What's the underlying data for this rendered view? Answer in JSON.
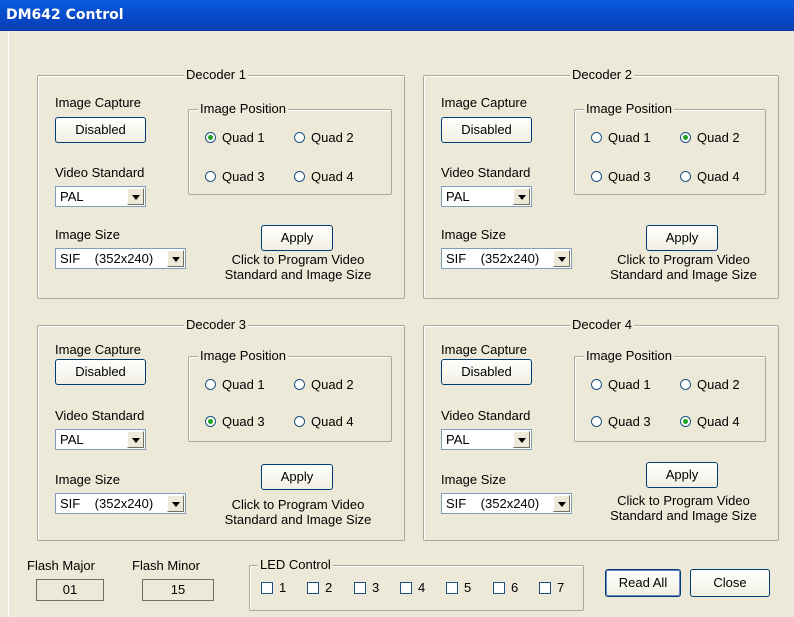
{
  "window": {
    "title": "DM642 Control"
  },
  "labels": {
    "image_capture": "Image Capture",
    "image_position": "Image Position",
    "video_standard": "Video Standard",
    "image_size": "Image Size",
    "apply": "Apply",
    "hint_line1": "Click to Program Video",
    "hint_line2": "Standard and Image Size"
  },
  "decoders": [
    {
      "title": "Decoder 1",
      "capture_button": "Disabled",
      "video_standard": "PAL",
      "image_size": "SIF    (352x240)",
      "quads": [
        "Quad 1",
        "Quad 2",
        "Quad 3",
        "Quad 4"
      ],
      "selected_quad": "Quad 1"
    },
    {
      "title": "Decoder 2",
      "capture_button": "Disabled",
      "video_standard": "PAL",
      "image_size": "SIF    (352x240)",
      "quads": [
        "Quad 1",
        "Quad 2",
        "Quad 3",
        "Quad 4"
      ],
      "selected_quad": "Quad 2"
    },
    {
      "title": "Decoder 3",
      "capture_button": "Disabled",
      "video_standard": "PAL",
      "image_size": "SIF    (352x240)",
      "quads": [
        "Quad 1",
        "Quad 2",
        "Quad 3",
        "Quad 4"
      ],
      "selected_quad": "Quad 3"
    },
    {
      "title": "Decoder 4",
      "capture_button": "Disabled",
      "video_standard": "PAL",
      "image_size": "SIF    (352x240)",
      "quads": [
        "Quad 1",
        "Quad 2",
        "Quad 3",
        "Quad 4"
      ],
      "selected_quad": "Quad 4"
    }
  ],
  "flash": {
    "major_label": "Flash Major",
    "major_value": "01",
    "minor_label": "Flash Minor",
    "minor_value": "15"
  },
  "led_control": {
    "title": "LED Control",
    "leds": [
      "1",
      "2",
      "3",
      "4",
      "5",
      "6",
      "7"
    ]
  },
  "buttons": {
    "read_all": "Read All",
    "close": "Close"
  }
}
